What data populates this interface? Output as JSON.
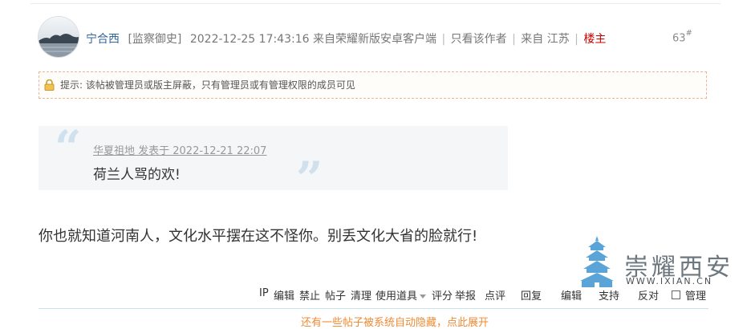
{
  "post": {
    "author": "宁合西",
    "rank": "[监察御史]",
    "timestamp": "2022-12-25 17:43:16",
    "client": "来自荣耀新版安卓客户端",
    "only_author": "只看该作者",
    "location": "来自 江苏",
    "owner_badge": "楼主",
    "floor_num": "63",
    "floor_mark": "#",
    "separator": "|"
  },
  "notice": {
    "text": "提示: 该帖被管理员或版主屏蔽，只有管理员或有管理权限的成员可见",
    "icon": "lock-icon"
  },
  "quote": {
    "header": "华夏祖地 发表于 2022-12-21 22:07",
    "text": "荷兰人骂的欢!",
    "open_mark": "“",
    "close_mark": "”"
  },
  "body_text": "你也就知道河南人，文化水平摆在这不怪你。别丢文化大省的脸就行!",
  "watermark": {
    "title": "崇耀西安",
    "url": "WWW.IXIAN.CN",
    "icon": "pagoda-logo"
  },
  "actions": {
    "ip": "IP",
    "edit1": "编辑",
    "ban": "禁止",
    "posts": "帖子",
    "clear": "清理",
    "tools": "使用道具",
    "rate": "评分",
    "report": "举报",
    "review": "点评",
    "reply": "回复",
    "edit2": "编辑",
    "support": "支持",
    "oppose": "反对",
    "manage": "管理"
  },
  "footnote": "还有一些帖子被系统自动隐藏，点此展开",
  "colors": {
    "author": "#336699",
    "owner": "#cc0000",
    "notice_border": "#f0b393",
    "quote_bg": "#f5f6f7",
    "quote_mark": "#cfe0ee",
    "footnote": "#f08a33"
  }
}
